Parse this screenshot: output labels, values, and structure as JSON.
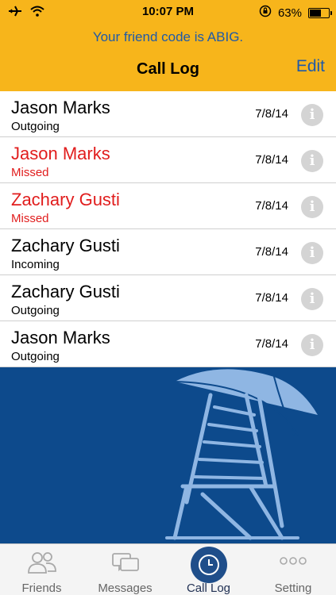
{
  "status_bar": {
    "time": "10:07 PM",
    "battery": "63%",
    "battery_level": 0.63
  },
  "header": {
    "friend_code_text": "Your friend code is ABIG.",
    "title": "Call Log",
    "edit_label": "Edit"
  },
  "calls": [
    {
      "name": "Jason Marks",
      "type": "Outgoing",
      "date": "7/8/14",
      "missed": false
    },
    {
      "name": "Jason Marks",
      "type": "Missed",
      "date": "7/8/14",
      "missed": true
    },
    {
      "name": "Zachary Gusti",
      "type": "Missed",
      "date": "7/8/14",
      "missed": true
    },
    {
      "name": "Zachary Gusti",
      "type": "Incoming",
      "date": "7/8/14",
      "missed": false
    },
    {
      "name": "Zachary Gusti",
      "type": "Outgoing",
      "date": "7/8/14",
      "missed": false
    },
    {
      "name": "Jason Marks",
      "type": "Outgoing",
      "date": "7/8/14",
      "missed": false
    }
  ],
  "info_icon": "i",
  "tabs": [
    {
      "label": "Friends",
      "icon": "people-icon",
      "active": false
    },
    {
      "label": "Messages",
      "icon": "chat-bubbles-icon",
      "active": false
    },
    {
      "label": "Call Log",
      "icon": "clock-icon",
      "active": true
    },
    {
      "label": "Setting",
      "icon": "more-dots-icon",
      "active": false
    }
  ],
  "colors": {
    "header_bg": "#f7b51b",
    "accent_blue": "#1f5aa8",
    "missed_red": "#e11d1d",
    "background_blue": "#0d4a8c",
    "chair_blue": "#8fb6e3"
  }
}
